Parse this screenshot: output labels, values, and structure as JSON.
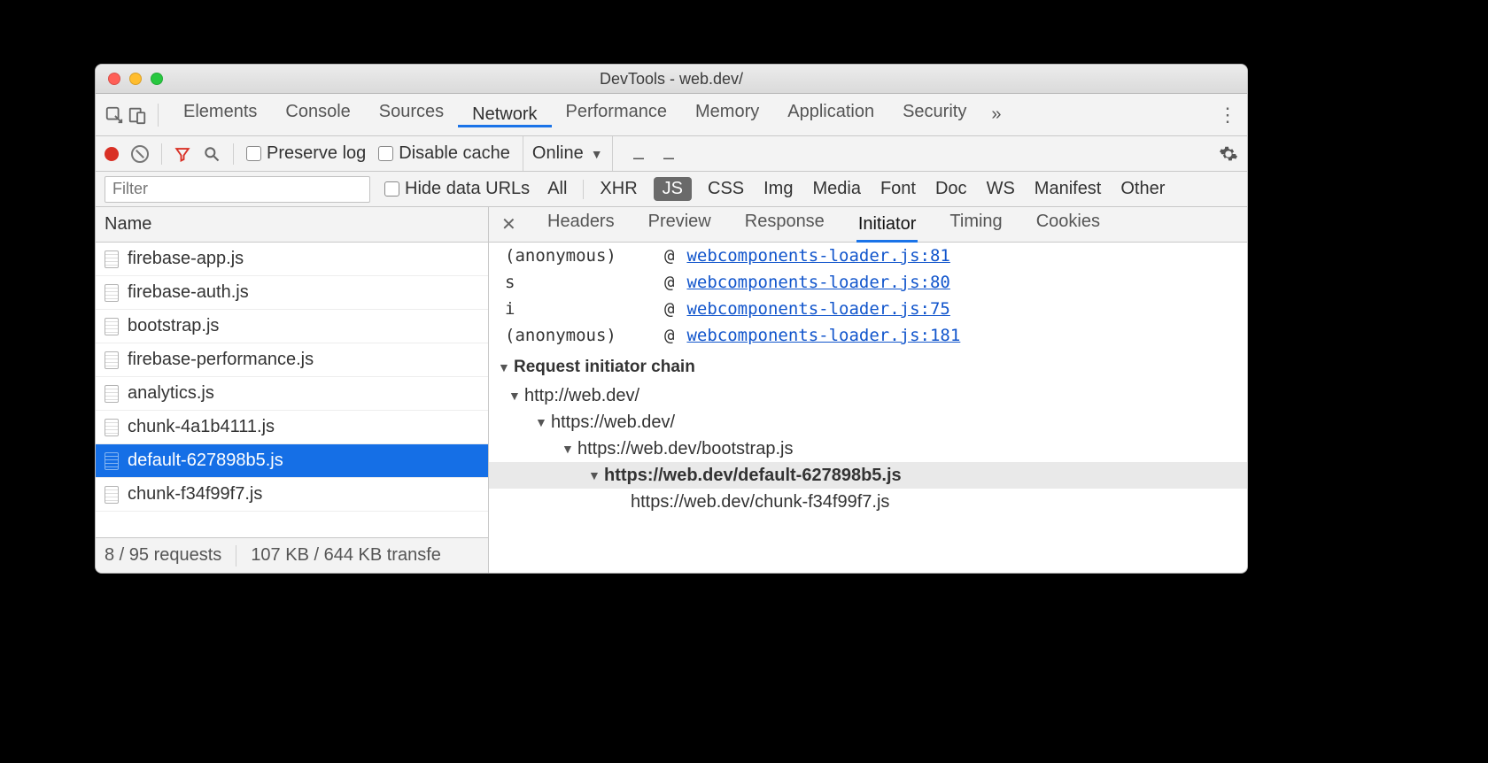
{
  "window": {
    "title": "DevTools - web.dev/"
  },
  "panels": {
    "tabs": [
      "Elements",
      "Console",
      "Sources",
      "Network",
      "Performance",
      "Memory",
      "Application",
      "Security"
    ],
    "active": "Network",
    "overflow": "»"
  },
  "netToolbar": {
    "preserve_label": "Preserve log",
    "disable_label": "Disable cache",
    "throttle": "Online"
  },
  "filterBar": {
    "placeholder": "Filter",
    "hide_label": "Hide data URLs",
    "types": [
      "All",
      "XHR",
      "JS",
      "CSS",
      "Img",
      "Media",
      "Font",
      "Doc",
      "WS",
      "Manifest",
      "Other"
    ],
    "active": "JS"
  },
  "requestList": {
    "header": "Name",
    "rows": [
      {
        "name": "firebase-app.js"
      },
      {
        "name": "firebase-auth.js"
      },
      {
        "name": "bootstrap.js"
      },
      {
        "name": "firebase-performance.js"
      },
      {
        "name": "analytics.js"
      },
      {
        "name": "chunk-4a1b4111.js"
      },
      {
        "name": "default-627898b5.js",
        "selected": true
      },
      {
        "name": "chunk-f34f99f7.js"
      }
    ],
    "footer": {
      "counts": "8 / 95 requests",
      "transfer": "107 KB / 644 KB transfe"
    }
  },
  "detail": {
    "tabs": [
      "Headers",
      "Preview",
      "Response",
      "Initiator",
      "Timing",
      "Cookies"
    ],
    "active": "Initiator",
    "stack": [
      {
        "fn": "(anonymous)",
        "loc": "webcomponents-loader.js:81"
      },
      {
        "fn": "s",
        "loc": "webcomponents-loader.js:80"
      },
      {
        "fn": "i",
        "loc": "webcomponents-loader.js:75"
      },
      {
        "fn": "(anonymous)",
        "loc": "webcomponents-loader.js:181"
      }
    ],
    "chain_title": "Request initiator chain",
    "chain": [
      {
        "indent": 0,
        "url": "http://web.dev/",
        "arrow": true
      },
      {
        "indent": 1,
        "url": "https://web.dev/",
        "arrow": true
      },
      {
        "indent": 2,
        "url": "https://web.dev/bootstrap.js",
        "arrow": true
      },
      {
        "indent": 3,
        "url": "https://web.dev/default-627898b5.js",
        "arrow": true,
        "current": true
      },
      {
        "indent": 4,
        "url": "https://web.dev/chunk-f34f99f7.js",
        "arrow": false
      }
    ]
  }
}
